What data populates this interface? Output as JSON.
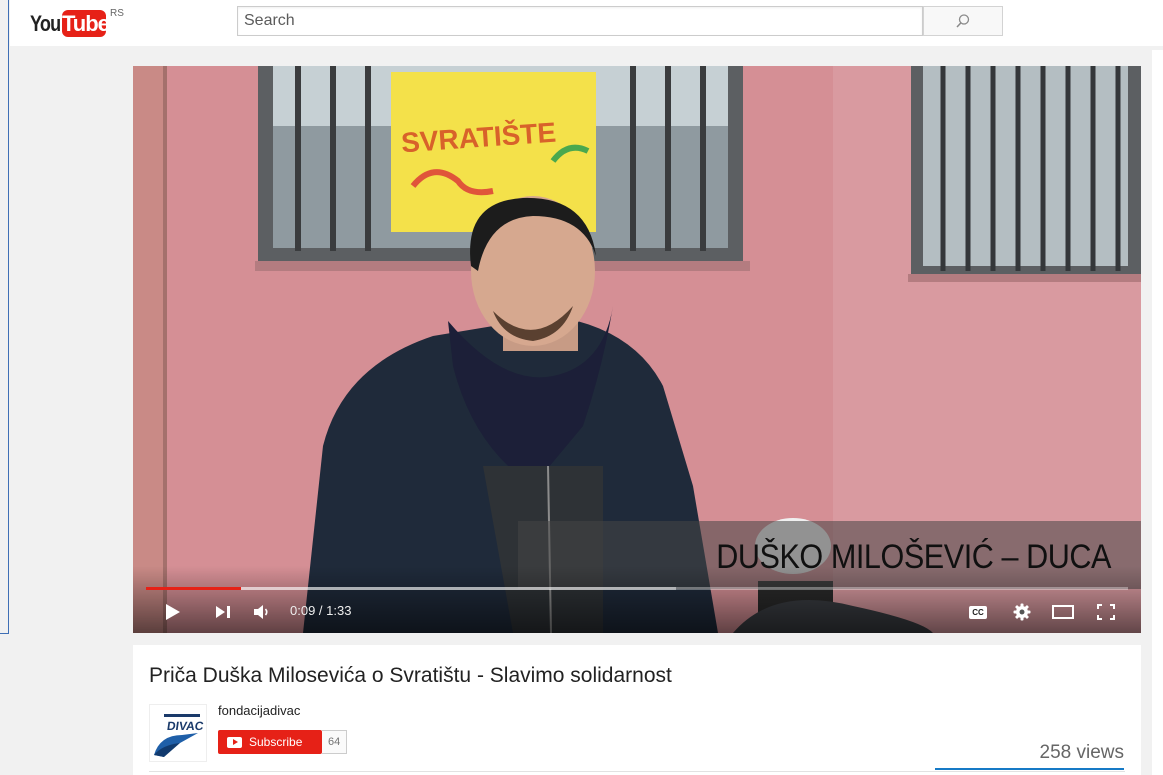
{
  "masthead": {
    "logo_you": "You",
    "logo_tube": "Tube",
    "country_code": "RS",
    "search_placeholder": "Search",
    "search_icon": "search-icon"
  },
  "player": {
    "caption": "DUŠKO MILOŠEVIĆ – DUCA",
    "sign_text": "SVRATIŠTE",
    "current_time": "0:09",
    "duration": "1:33",
    "time_display": "0:09 / 1:33",
    "progress_fraction": 0.097,
    "buffered_fraction": 0.54,
    "icons": [
      "play-icon",
      "next-icon",
      "volume-icon",
      "captions-icon",
      "settings-icon",
      "theater-mode-icon",
      "fullscreen-icon"
    ],
    "cc_label": "CC"
  },
  "video": {
    "title": "Priča Duška Milosevića o Svratištu - Slavimo solidarnost",
    "channel_name": "fondacijadivac",
    "channel_logo_text": "DIVAC",
    "subscribe_label": "Subscribe",
    "subscriber_count": "64",
    "views": "258 views"
  },
  "colors": {
    "brand_red": "#e62117",
    "accent_blue": "#167ac6",
    "page_bg": "#f1f1f1"
  }
}
